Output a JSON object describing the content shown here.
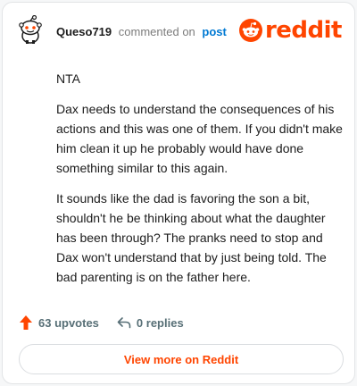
{
  "comment": {
    "username": "Queso719",
    "action_text": "commented on",
    "post_link": "post",
    "paragraphs": [
      "NTA",
      "Dax needs to understand the consequences of his actions and this was one of them. If you didn't make him clean it up he probably would have done something similar to this again.",
      "It sounds like the dad is favoring the son a bit, shouldn't he be thinking about what the daughter has been through? The pranks need to stop and Dax won't understand that by just being told. The bad parenting is on the father here."
    ]
  },
  "brand": {
    "logo_text": "reddit",
    "accent_color": "#ff4500"
  },
  "stats": {
    "upvotes": "63 upvotes",
    "replies": "0 replies",
    "upvote_icon": "arrow-up-icon",
    "reply_icon": "reply-arrow-icon"
  },
  "cta": {
    "label": "View more on Reddit"
  }
}
